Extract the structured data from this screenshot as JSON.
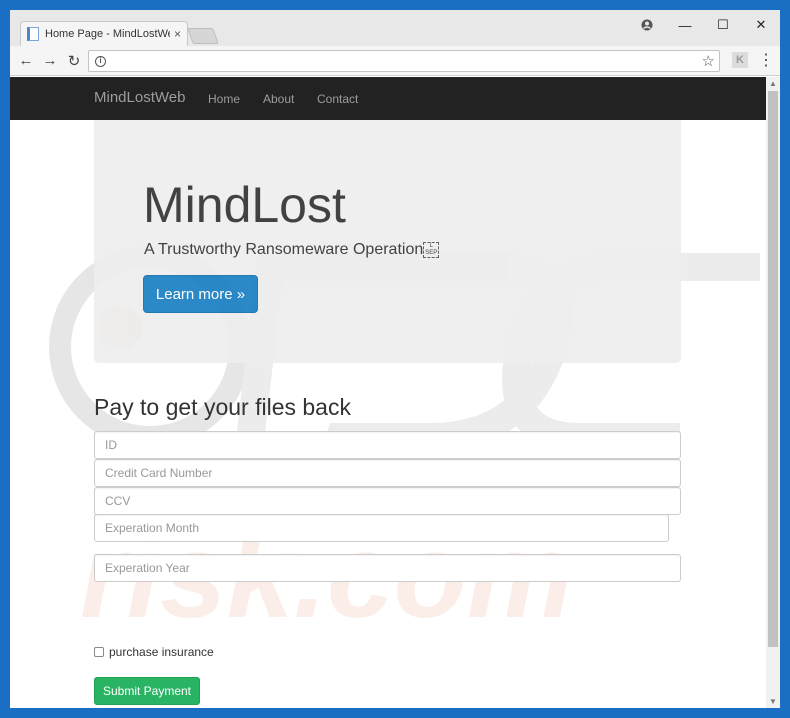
{
  "browser": {
    "tab_title": "Home Page - MindLostWe",
    "tab_close": "×",
    "minimize": "—",
    "maximize": "☐",
    "close": "✕"
  },
  "toolbar": {
    "back": "←",
    "forward": "→",
    "reload": "↻",
    "info": "i",
    "bookmark": "☆",
    "extension": "K",
    "menu": "⋮"
  },
  "site": {
    "brand": "MindLostWeb",
    "nav": [
      "Home",
      "About",
      "Contact"
    ]
  },
  "jumbotron": {
    "title": "MindLost",
    "subtitle": "A Trustworthy Ransomeware Operation",
    "sep_glyph_top": "L",
    "sep_glyph_bottom": "SEP",
    "button": "Learn more »"
  },
  "payment": {
    "title": "Pay to get your files back",
    "fields": {
      "id": "ID",
      "card": "Credit Card Number",
      "ccv": "CCV",
      "month": "Experation Month",
      "year": "Experation Year"
    },
    "insurance_label": "purchase insurance",
    "submit": "Submit Payment"
  },
  "colors": {
    "navbar": "#222222",
    "primary": "#1a7fc3",
    "success": "#28b463",
    "frame": "#1a6fc4"
  }
}
